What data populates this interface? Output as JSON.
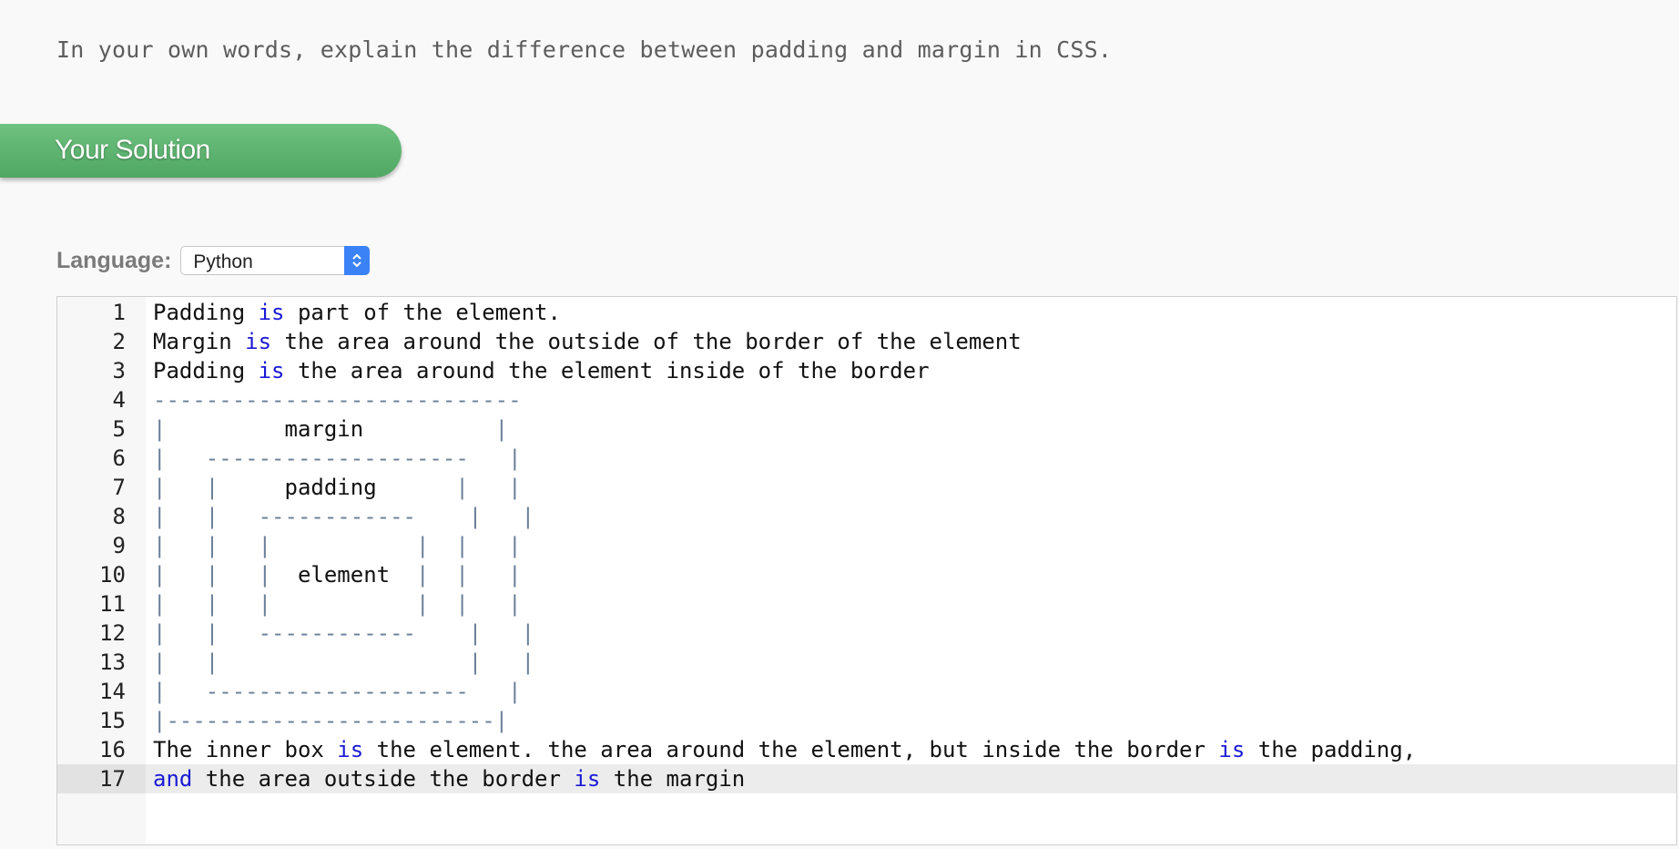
{
  "question": {
    "text": "In your own words, explain the difference between padding and margin in CSS."
  },
  "solution": {
    "banner_label": "Your Solution"
  },
  "language": {
    "label": "Language:",
    "selected": "Python"
  },
  "editor": {
    "active_line": 17,
    "lines": [
      {
        "n": "1",
        "parts": [
          [
            "t",
            "Padding "
          ],
          [
            "k",
            "is"
          ],
          [
            "t",
            " part of the element."
          ]
        ]
      },
      {
        "n": "2",
        "parts": [
          [
            "t",
            "Margin "
          ],
          [
            "k",
            "is"
          ],
          [
            "t",
            " the area around the outside of the border of the element"
          ]
        ]
      },
      {
        "n": "3",
        "parts": [
          [
            "t",
            "Padding "
          ],
          [
            "k",
            "is"
          ],
          [
            "t",
            " the area around the element inside of the border"
          ]
        ]
      },
      {
        "n": "4",
        "parts": [
          [
            "a",
            "----------------------------"
          ]
        ]
      },
      {
        "n": "5",
        "parts": [
          [
            "a",
            "|"
          ],
          [
            "t",
            "         margin         "
          ],
          [
            "a",
            " |"
          ]
        ]
      },
      {
        "n": "6",
        "parts": [
          [
            "a",
            "|   --------------------   |"
          ]
        ]
      },
      {
        "n": "7",
        "parts": [
          [
            "a",
            "|   |"
          ],
          [
            "t",
            "     padding      "
          ],
          [
            "a",
            "|   |"
          ]
        ]
      },
      {
        "n": "8",
        "parts": [
          [
            "a",
            "|   |   ------------    |   |"
          ]
        ]
      },
      {
        "n": "9",
        "parts": [
          [
            "a",
            "|   |   |           |  |   |"
          ]
        ]
      },
      {
        "n": "10",
        "parts": [
          [
            "a",
            "|   |   | "
          ],
          [
            "t",
            " element "
          ],
          [
            "a",
            " |  |   |"
          ]
        ]
      },
      {
        "n": "11",
        "parts": [
          [
            "a",
            "|   |   |           |  |   |"
          ]
        ]
      },
      {
        "n": "12",
        "parts": [
          [
            "a",
            "|   |   ------------    |   |"
          ]
        ]
      },
      {
        "n": "13",
        "parts": [
          [
            "a",
            "|   |                   |   |"
          ]
        ]
      },
      {
        "n": "14",
        "parts": [
          [
            "a",
            "|   --------------------   |"
          ]
        ]
      },
      {
        "n": "15",
        "parts": [
          [
            "a",
            "|-------------------------|"
          ]
        ]
      },
      {
        "n": "16",
        "parts": [
          [
            "t",
            "The inner box "
          ],
          [
            "k",
            "is"
          ],
          [
            "t",
            " the element. the area around the element, but inside the border "
          ],
          [
            "k",
            "is"
          ],
          [
            "t",
            " the padding,"
          ]
        ]
      },
      {
        "n": "17",
        "parts": [
          [
            "k",
            "and"
          ],
          [
            "t",
            " the area outside the border "
          ],
          [
            "k",
            "is"
          ],
          [
            "t",
            " the margin"
          ]
        ]
      }
    ]
  }
}
